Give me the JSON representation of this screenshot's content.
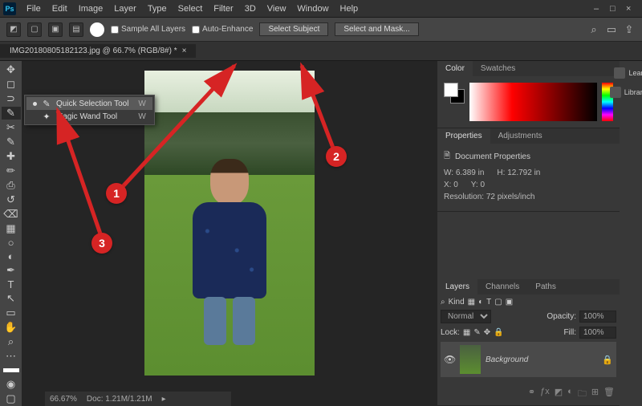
{
  "app": {
    "name": "Ps"
  },
  "menu": [
    "File",
    "Edit",
    "Image",
    "Layer",
    "Type",
    "Select",
    "Filter",
    "3D",
    "View",
    "Window",
    "Help"
  ],
  "options": {
    "sample_all": "Sample All Layers",
    "auto_enhance": "Auto-Enhance",
    "select_subject": "Select Subject",
    "select_mask": "Select and Mask..."
  },
  "tab": {
    "title": "IMG20180805182123.jpg @ 66.7% (RGB/8#) *"
  },
  "flyout": {
    "items": [
      {
        "label": "Quick Selection Tool",
        "shortcut": "W",
        "selected": true
      },
      {
        "label": "Magic Wand Tool",
        "shortcut": "W",
        "selected": false
      }
    ]
  },
  "status": {
    "zoom": "66.67%",
    "doc": "Doc: 1.21M/1.21M"
  },
  "panels": {
    "color": {
      "tabs": [
        "Color",
        "Swatches"
      ]
    },
    "properties": {
      "tabs": [
        "Properties",
        "Adjustments"
      ],
      "title": "Document Properties",
      "w_label": "W:",
      "w": "6.389 in",
      "h_label": "H:",
      "h": "12.792 in",
      "x_label": "X:",
      "x": "0",
      "y_label": "Y:",
      "y": "0",
      "res_label": "Resolution:",
      "res": "72 pixels/inch"
    },
    "layers": {
      "tabs": [
        "Layers",
        "Channels",
        "Paths"
      ],
      "kind": "Kind",
      "blend": "Normal",
      "opacity_label": "Opacity:",
      "opacity": "100%",
      "lock_label": "Lock:",
      "fill_label": "Fill:",
      "fill": "100%",
      "layer_name": "Background"
    },
    "side": [
      "Learn",
      "Libraries"
    ]
  },
  "annotations": {
    "a1": "1",
    "a2": "2",
    "a3": "3"
  }
}
